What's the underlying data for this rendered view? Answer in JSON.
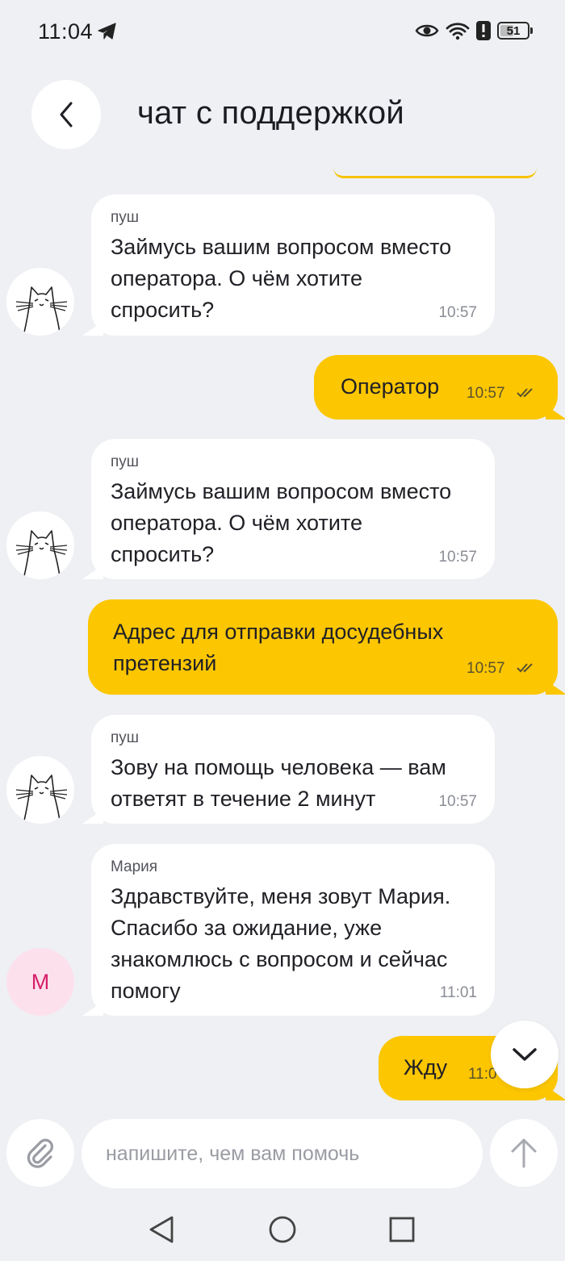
{
  "status_bar": {
    "time": "11:04",
    "battery": "51"
  },
  "header": {
    "title": "чат с поддержкой"
  },
  "messages": [
    {
      "direction": "in",
      "sender": "пуш",
      "lines": [
        "Займусь вашим вопросом вместо",
        "оператора. О чём хотите",
        "спросить?"
      ],
      "time": "10:57",
      "avatar": "cat"
    },
    {
      "direction": "out",
      "lines": [
        "Оператор"
      ],
      "time": "10:57",
      "status": "read"
    },
    {
      "direction": "in",
      "sender": "пуш",
      "lines": [
        "Займусь вашим вопросом вместо",
        "оператора. О чём хотите",
        "спросить?"
      ],
      "time": "10:57",
      "avatar": "cat"
    },
    {
      "direction": "out",
      "lines": [
        "Адрес для отправки досудебных",
        "претензий"
      ],
      "time": "10:57",
      "status": "read"
    },
    {
      "direction": "in",
      "sender": "пуш",
      "lines": [
        "Зову на помощь человека — вам",
        "ответят в течение 2 минут"
      ],
      "time": "10:57",
      "avatar": "cat"
    },
    {
      "direction": "in",
      "sender": "Мария",
      "lines": [
        "Здравствуйте, меня зовут Мария.",
        "Спасибо за ожидание, уже",
        "знакомлюсь с вопросом и сейчас",
        "помогу"
      ],
      "time": "11:01",
      "avatar_letter": "М"
    },
    {
      "direction": "out",
      "lines": [
        "Жду"
      ],
      "time": "11:0",
      "status": "read"
    }
  ],
  "composer": {
    "placeholder": "напишите, чем вам помочь"
  },
  "icons": {
    "back": "chevron-left-icon",
    "scroll_down": "chevron-down-icon",
    "attach": "paperclip-icon",
    "send": "arrow-up-icon",
    "avatar_bot": "cat-icon"
  },
  "colors": {
    "background": "#eef0f3",
    "outgoing_bubble": "#fcc600",
    "incoming_bubble": "#ffffff",
    "agent_avatar_bg": "#fce1ec",
    "agent_avatar_text": "#d61e6a"
  }
}
